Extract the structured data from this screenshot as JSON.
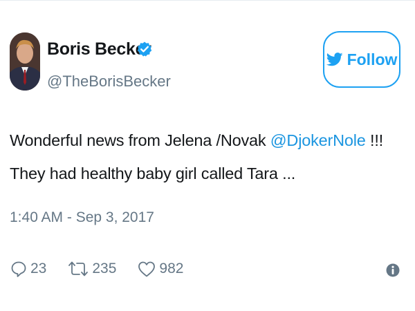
{
  "author": {
    "name": "Boris Becker",
    "handle": "@TheBorisBecker",
    "verified_icon": "verified-badge-icon",
    "avatar": "avatar"
  },
  "follow_button": {
    "label": "Follow",
    "icon": "twitter-bird-icon"
  },
  "tweet": {
    "text_before": "Wonderful news from Jelena /Novak ",
    "mention": "@DjokerNole",
    "text_after": " !!! They had healthy baby girl called Tara ...",
    "timestamp": "1:40 AM - Sep 3, 2017"
  },
  "actions": {
    "reply": {
      "icon": "reply-icon",
      "count": "23"
    },
    "retweet": {
      "icon": "retweet-icon",
      "count": "235"
    },
    "like": {
      "icon": "heart-icon",
      "count": "982"
    },
    "info": {
      "icon": "info-icon"
    }
  },
  "colors": {
    "accent": "#1da1f2",
    "mention": "#1b95e0",
    "text": "#14171a",
    "muted": "#657786"
  }
}
